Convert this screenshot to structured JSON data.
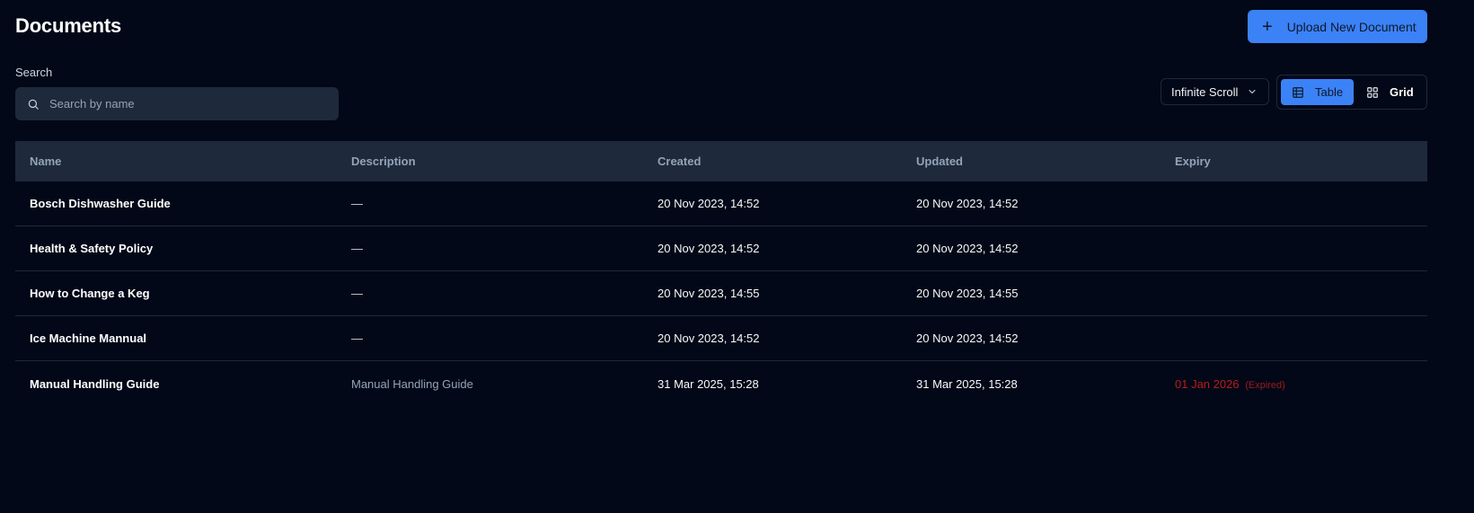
{
  "header": {
    "title": "Documents",
    "upload_label": "Upload New Document",
    "upload_icon": "plus-icon"
  },
  "search": {
    "label": "Search",
    "placeholder": "Search by name",
    "value": ""
  },
  "controls": {
    "pagination_mode": "Infinite Scroll",
    "view_table": "Table",
    "view_grid": "Grid",
    "active_view": "Table"
  },
  "table": {
    "columns": [
      "Name",
      "Description",
      "Created",
      "Updated",
      "Expiry"
    ],
    "rows": [
      {
        "name": "Bosch Dishwasher Guide",
        "description": "—",
        "created": "20 Nov 2023, 14:52",
        "updated": "20 Nov 2023, 14:52",
        "expiry": "",
        "expiry_status": ""
      },
      {
        "name": "Health & Safety Policy",
        "description": "—",
        "created": "20 Nov 2023, 14:52",
        "updated": "20 Nov 2023, 14:52",
        "expiry": "",
        "expiry_status": ""
      },
      {
        "name": "How to Change a Keg",
        "description": "—",
        "created": "20 Nov 2023, 14:55",
        "updated": "20 Nov 2023, 14:55",
        "expiry": "",
        "expiry_status": ""
      },
      {
        "name": "Ice Machine Mannual",
        "description": "—",
        "created": "20 Nov 2023, 14:52",
        "updated": "20 Nov 2023, 14:52",
        "expiry": "",
        "expiry_status": ""
      },
      {
        "name": "Manual Handling Guide",
        "description": "Manual Handling Guide",
        "created": "31 Mar 2025, 15:28",
        "updated": "31 Mar 2025, 15:28",
        "expiry": "01 Jan 2026",
        "expiry_status": "(Expired)"
      }
    ]
  },
  "colors": {
    "background": "#020817",
    "accent": "#3b82f6",
    "expired": "#b91c1c"
  }
}
